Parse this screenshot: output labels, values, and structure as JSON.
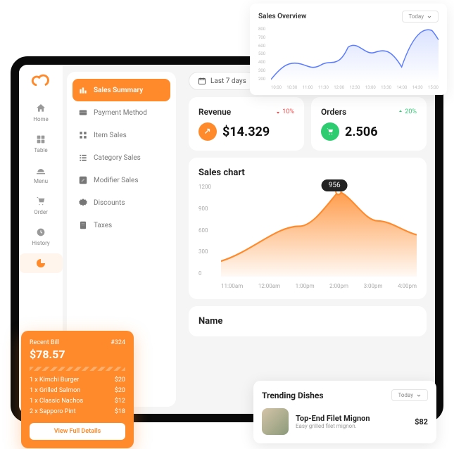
{
  "sidebar": {
    "items": [
      {
        "label": "Home"
      },
      {
        "label": "Table"
      },
      {
        "label": "Menu"
      },
      {
        "label": "Order"
      },
      {
        "label": "History"
      },
      {
        "label": ""
      }
    ]
  },
  "menu": {
    "items": [
      {
        "label": "Sales Summary"
      },
      {
        "label": "Payment Method"
      },
      {
        "label": "Item Sales"
      },
      {
        "label": "Category Sales"
      },
      {
        "label": "Modifier Sales"
      },
      {
        "label": "Discounts"
      },
      {
        "label": "Taxes"
      }
    ]
  },
  "date_range": "Last 7 days",
  "revenue": {
    "title": "Revenue",
    "delta": "10%",
    "value": "$14.329"
  },
  "orders": {
    "title": "Orders",
    "delta": "20%",
    "value": "2.506"
  },
  "sales_chart_title": "Sales chart",
  "name_header": "Name",
  "overview": {
    "title": "Sales Overview",
    "range": "Today"
  },
  "bill": {
    "title": "Recent Bill",
    "id": "#324",
    "amount": "$78.57",
    "items": [
      {
        "name": "1 x Kimchi Burger",
        "price": "$20"
      },
      {
        "name": "1 x Grilled Salmon",
        "price": "$20"
      },
      {
        "name": "1 x Classic Nachos",
        "price": "$12"
      },
      {
        "name": "2 x Sapporo Pint",
        "price": "$18"
      }
    ],
    "button": "View Full Details"
  },
  "trending": {
    "title": "Trending Dishes",
    "range": "Today",
    "dish": {
      "name": "Top-End Filet Mignon",
      "desc": "Easy grilled filet mignon.",
      "price": "$82"
    }
  },
  "chart_data": [
    {
      "type": "line",
      "title": "Sales Overview",
      "x": [
        "10:00",
        "10:30",
        "11:00",
        "11:30",
        "12:00",
        "12:30",
        "13:00",
        "13:30",
        "14:00",
        "14:30",
        "15:00"
      ],
      "values": [
        200,
        420,
        350,
        440,
        370,
        620,
        550,
        580,
        430,
        760,
        670
      ],
      "ylim": [
        200,
        800
      ],
      "ylabel": "",
      "xlabel": ""
    },
    {
      "type": "area",
      "title": "Sales chart",
      "x": [
        "11:00am",
        "12:00am",
        "1:00pm",
        "2:00pm",
        "3:00pm",
        "4:00pm"
      ],
      "values": [
        200,
        450,
        650,
        1100,
        720,
        540
      ],
      "ylim": [
        0,
        1200
      ],
      "tooltip": 956,
      "ylabel": "",
      "xlabel": ""
    }
  ]
}
